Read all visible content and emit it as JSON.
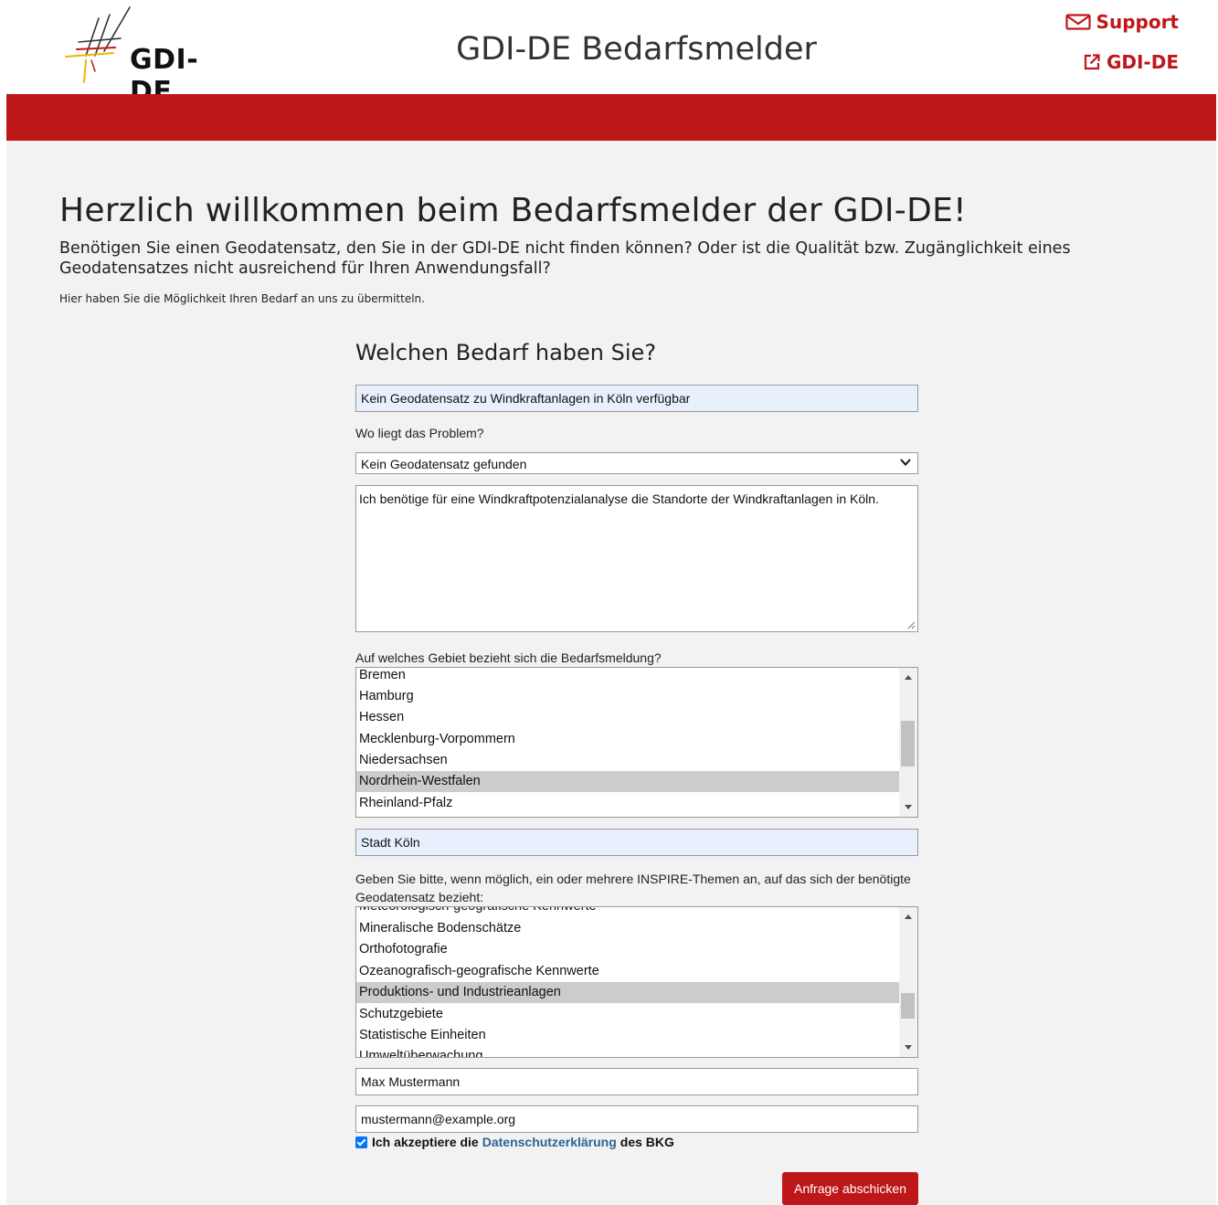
{
  "header": {
    "logo_text": "GDI-DE",
    "title": "GDI-DE Bedarfsmelder",
    "links": {
      "support": "Support",
      "gdi": "GDI-DE"
    }
  },
  "welcome": {
    "heading": "Herzlich willkommen beim Bedarfsmelder der GDI-DE!",
    "intro": "Benötigen Sie einen Geodatensatz, den Sie in der GDI-DE nicht finden können? Oder ist die Qualität bzw. Zugänglichkeit eines Geodatensatzes nicht ausreichend für Ihren Anwendungsfall?",
    "small": "Hier haben Sie die Möglichkeit Ihren Bedarf an uns zu übermitteln."
  },
  "form": {
    "title": "Welchen Bedarf haben Sie?",
    "subject_value": "Kein Geodatensatz zu Windkraftanlagen in Köln verfügbar",
    "problem_label": "Wo liegt das Problem?",
    "problem_selected": "Kein Geodatensatz gefunden",
    "description_value": "Ich benötige für eine Windkraftpotenzialanalyse die Standorte der Windkraftanlagen in Köln.",
    "area_label": "Auf welches Gebiet bezieht sich die Bedarfsmeldung?",
    "area_options": [
      "Bremen",
      "Hamburg",
      "Hessen",
      "Mecklenburg-Vorpommern",
      "Niedersachsen",
      "Nordrhein-Westfalen",
      "Rheinland-Pfalz"
    ],
    "area_selected": "Nordrhein-Westfalen",
    "area_detail_value": "Stadt Köln",
    "themes_label": "Geben Sie bitte, wenn möglich, ein oder mehrere INSPIRE-Themen an, auf das sich der benötigte Geodatensatz bezieht:",
    "theme_options": [
      "Meteorologisch-geografische Kennwerte",
      "Mineralische Bodenschätze",
      "Orthofotografie",
      "Ozeanografisch-geografische Kennwerte",
      "Produktions- und Industrieanlagen",
      "Schutzgebiete",
      "Statistische Einheiten",
      "Umweltüberwachung"
    ],
    "theme_selected": "Produktions- und Industrieanlagen",
    "name_value": "Max Mustermann",
    "email_value": "mustermann@example.org",
    "consent_checked": true,
    "consent_prefix": "Ich akzeptiere die",
    "consent_link": "Datenschutzerklärung",
    "consent_suffix": "des BKG",
    "submit_label": "Anfrage abschicken"
  },
  "colors": {
    "brand_red": "#bd1719",
    "link_blue": "#2a6496",
    "input_highlight": "#e8f0fe",
    "selected_option": "#cccccc",
    "content_bg": "#f2f2f2"
  },
  "icons": {
    "support": "mail-icon",
    "gdi": "external-link-icon",
    "select": "chevron-down-icon"
  }
}
